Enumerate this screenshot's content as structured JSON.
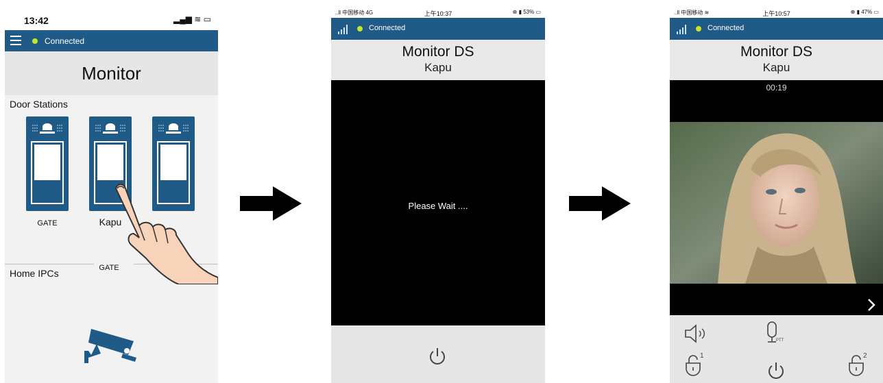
{
  "screen1": {
    "status_time": "13:42",
    "status_right": "▂▄▆ ≋ ▭",
    "connection": "Connected",
    "page_title": "Monitor",
    "section_door_stations": "Door Stations",
    "door_stations": [
      {
        "label": "GATE"
      },
      {
        "label": "Kapu"
      },
      {
        "label": "GATE"
      }
    ],
    "section_home_ipcs": "Home IPCs",
    "refresh_icon": "refresh-icon",
    "camera_icon": "cctv-camera-icon"
  },
  "screen2": {
    "status_left": "..ll 中国移动 4G",
    "status_time": "上午10:37",
    "status_right": "⊕ ▮ 53% ▭",
    "connection": "Connected",
    "title": "Monitor DS",
    "subtitle": "Kapu",
    "wait_text": "Please Wait ....",
    "power_icon": "power-icon"
  },
  "screen3": {
    "status_left": "..ll 中国移动 ≋",
    "status_time": "上午10:57",
    "status_right": "⊕ ▮ 47% ▭",
    "connection": "Connected",
    "title": "Monitor DS",
    "subtitle": "Kapu",
    "timer": "00:19",
    "next_icon": "chevron-right-icon",
    "speaker_icon": "speaker-icon",
    "mic_label": "PTT",
    "unlock1_label": "1",
    "unlock2_label": "2",
    "power_icon": "power-icon"
  },
  "colors": {
    "brand_blue": "#1f5b86",
    "connected_dot": "#c8e629",
    "video_bg": "#000000"
  }
}
